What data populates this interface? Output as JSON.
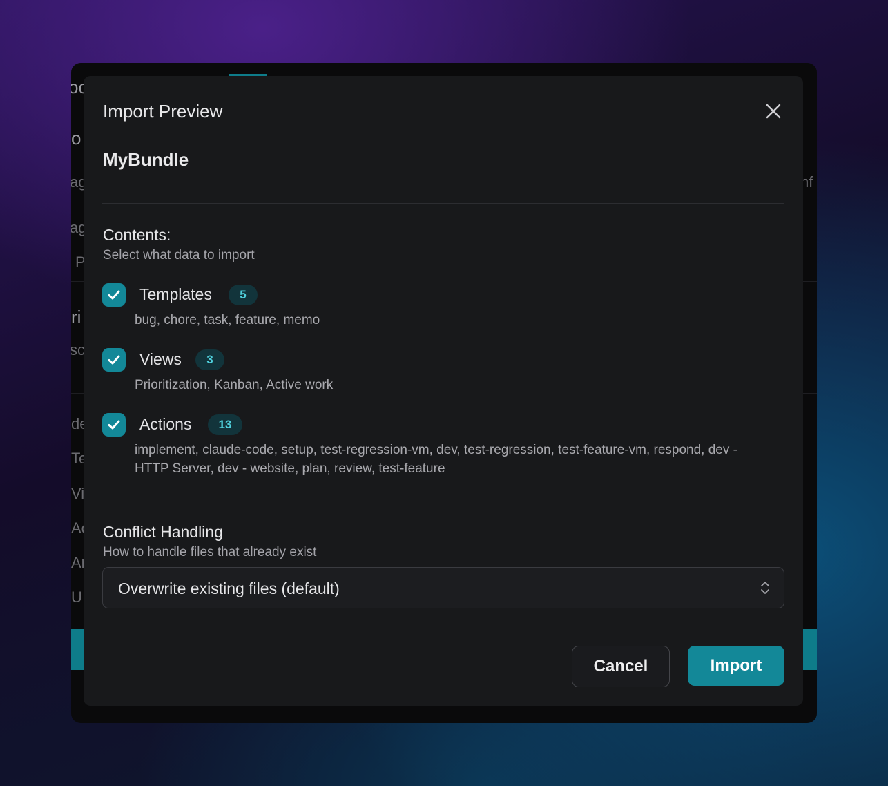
{
  "background": {
    "fragments": [
      "oc",
      "o",
      "ag",
      "ag",
      "P",
      "ri",
      "sc",
      "de",
      "Te",
      "Vi",
      "Ac",
      "Ar",
      "U",
      "nf"
    ]
  },
  "dialog": {
    "title": "Import Preview",
    "bundle_name": "MyBundle",
    "contents": {
      "heading": "Contents:",
      "subheading": "Select what data to import",
      "items": [
        {
          "label": "Templates",
          "count": "5",
          "checked": true,
          "description": "bug, chore, task, feature, memo"
        },
        {
          "label": "Views",
          "count": "3",
          "checked": true,
          "description": "Prioritization, Kanban, Active work"
        },
        {
          "label": "Actions",
          "count": "13",
          "checked": true,
          "description": "implement, claude-code, setup, test-regression-vm, dev, test-regression, test-feature-vm, respond, dev - HTTP Server, dev - website, plan, review, test-feature"
        }
      ]
    },
    "conflict": {
      "heading": "Conflict Handling",
      "subheading": "How to handle files that already exist",
      "selected": "Overwrite existing files (default)"
    },
    "buttons": {
      "cancel": "Cancel",
      "import": "Import"
    }
  },
  "colors": {
    "accent": "#138898",
    "badge_text": "#4fd0dc",
    "dialog_bg": "#18191b"
  },
  "icons": {
    "close": "close-icon",
    "check": "check-icon",
    "select": "chevron-up-down-icon"
  }
}
